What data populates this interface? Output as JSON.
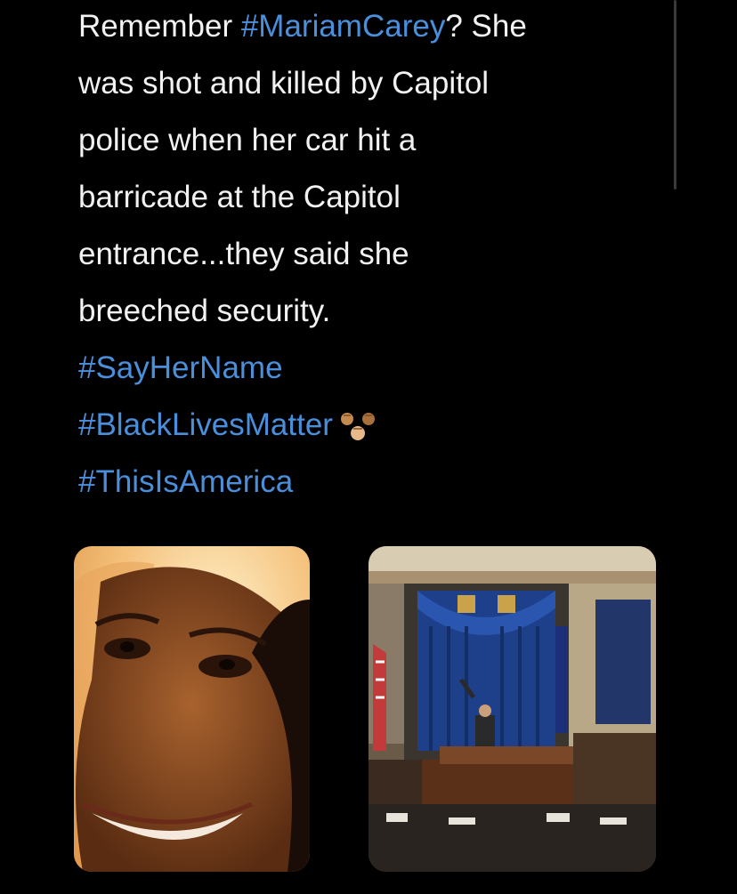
{
  "tweet": {
    "lines": [
      {
        "plain_before": "Remember ",
        "hashtag": "#MariamCarey",
        "plain_after": "? She"
      },
      {
        "text": "was shot and killed by Capitol"
      },
      {
        "text": "police when her car hit a"
      },
      {
        "text": "barricade at the Capitol"
      },
      {
        "text": "entrance...they said she"
      },
      {
        "text": "breeched security."
      }
    ],
    "hashtags": [
      "#SayHerName",
      "#BlackLivesMatter",
      "#ThisIsAmerica"
    ],
    "emoji": "raised-fists-emoji"
  },
  "media": {
    "left_image": "portrait-photo",
    "right_image": "senate-chamber-photo"
  },
  "colors": {
    "background": "#000000",
    "text": "#f2f2f2",
    "hashtag": "#4a8fdb"
  }
}
